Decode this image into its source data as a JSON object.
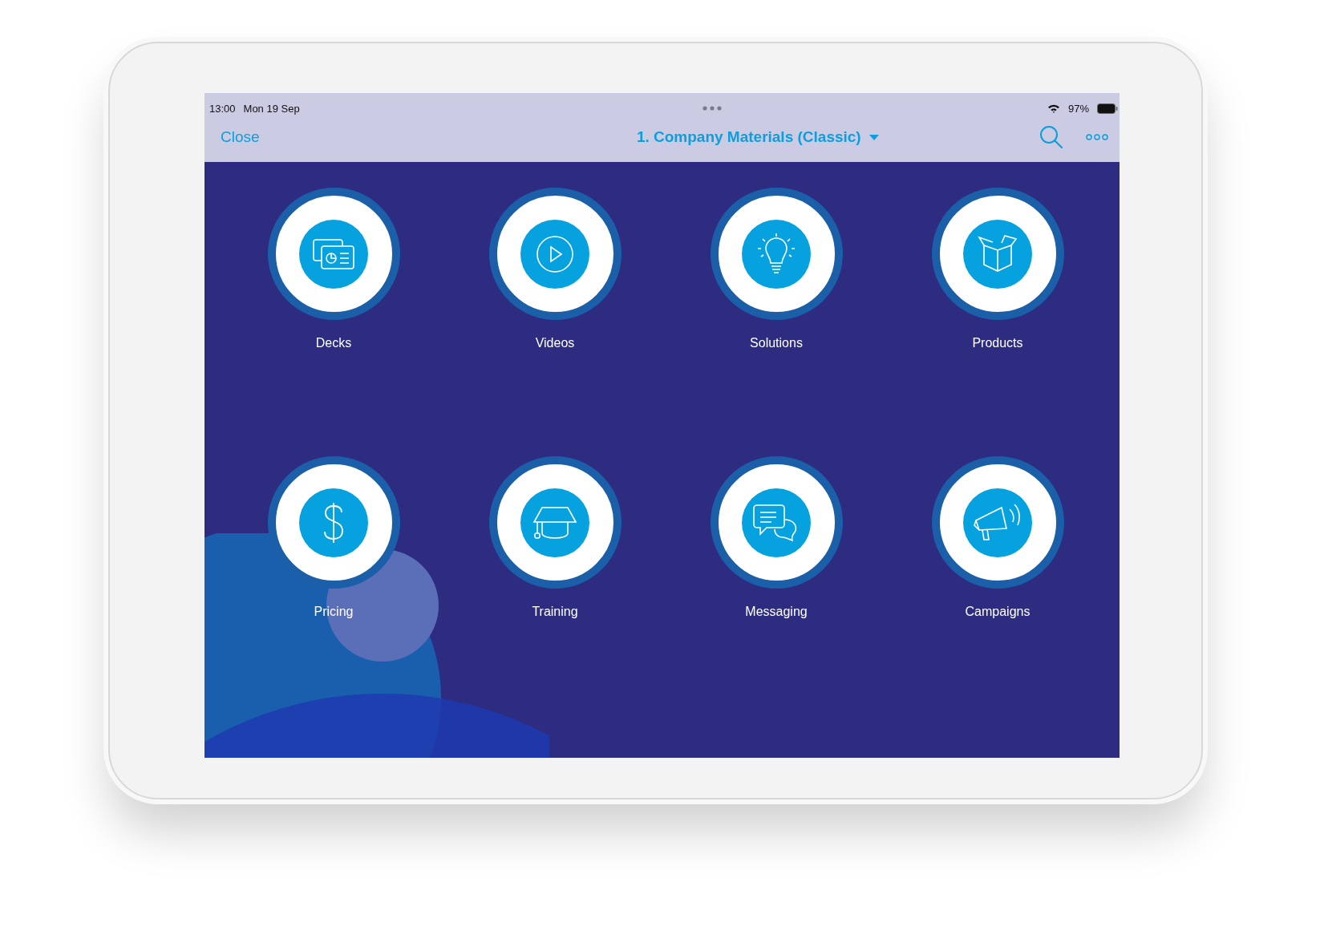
{
  "status_bar": {
    "time": "13:00",
    "date": "Mon 19 Sep",
    "battery": "97%"
  },
  "nav_bar": {
    "close": "Close",
    "title": "1. Company Materials (Classic)"
  },
  "tiles": [
    {
      "label": "Decks",
      "kind": "decks"
    },
    {
      "label": "Videos",
      "kind": "video"
    },
    {
      "label": "Solutions",
      "kind": "bulb"
    },
    {
      "label": "Products",
      "kind": "box"
    },
    {
      "label": "Pricing",
      "kind": "dollar"
    },
    {
      "label": "Training",
      "kind": "cap"
    },
    {
      "label": "Messaging",
      "kind": "chat"
    },
    {
      "label": "Campaigns",
      "kind": "megaphone"
    }
  ]
}
